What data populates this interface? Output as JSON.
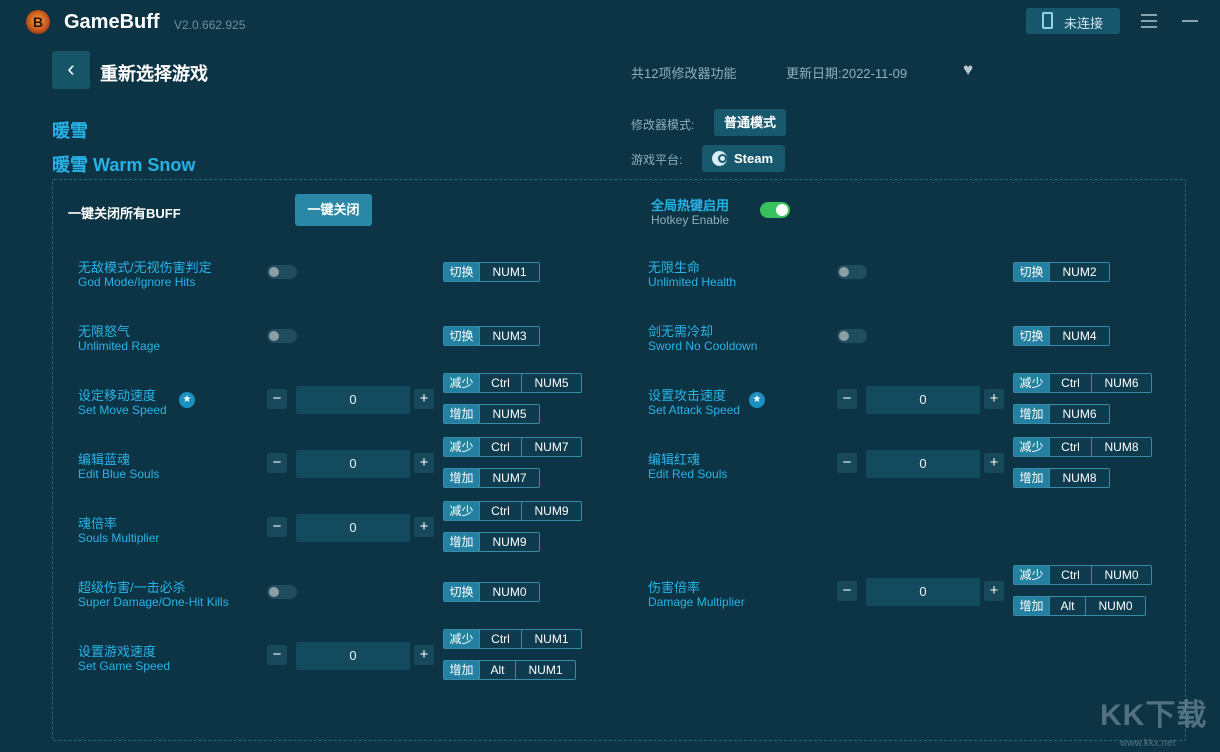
{
  "app": {
    "name": "GameBuff",
    "version": "V2.0.662.925",
    "logo_letter": "B",
    "connect_label": "未连接"
  },
  "header": {
    "back_label": "重新选择游戏",
    "feature_count": "共12项修改器功能",
    "update_date": "更新日期:2022-11-09"
  },
  "game": {
    "title_cn": "暖雪",
    "title_full": "暖雪 Warm Snow",
    "mode_label": "修改器模式:",
    "mode_value": "普通模式",
    "platform_label": "游戏平台:",
    "platform_value": "Steam"
  },
  "controls": {
    "close_all_label": "一键关闭所有BUFF",
    "close_all_button": "一键关闭",
    "hotkey_cn": "全局热键启用",
    "hotkey_en": "Hotkey Enable",
    "hotkey_enabled": true
  },
  "features": [
    {
      "cn": "无敌模式/无视伤害判定",
      "en": "God Mode/Ignore Hits",
      "type": "toggle",
      "hk1": {
        "action": "切换",
        "key": "NUM1"
      }
    },
    {
      "cn": "无限生命",
      "en": "Unlimited Health",
      "type": "toggle",
      "hk1": {
        "action": "切换",
        "key": "NUM2"
      }
    },
    {
      "cn": "无限怒气",
      "en": "Unlimited Rage",
      "type": "toggle",
      "hk1": {
        "action": "切换",
        "key": "NUM3"
      }
    },
    {
      "cn": "剑无需冷却",
      "en": "Sword No Cooldown",
      "type": "toggle",
      "hk1": {
        "action": "切换",
        "key": "NUM4"
      }
    },
    {
      "cn": "设定移动速度",
      "en": "Set Move Speed",
      "type": "number",
      "value": "0",
      "hk1": {
        "action": "减少",
        "mod": "Ctrl",
        "key": "NUM5"
      },
      "hk2": {
        "action": "增加",
        "key": "NUM5"
      }
    },
    {
      "cn": "设置攻击速度",
      "en": "Set Attack Speed",
      "type": "number",
      "value": "0",
      "hk1": {
        "action": "减少",
        "mod": "Ctrl",
        "key": "NUM6"
      },
      "hk2": {
        "action": "增加",
        "key": "NUM6"
      }
    },
    {
      "cn": "编辑蓝魂",
      "en": "Edit Blue Souls",
      "type": "number",
      "value": "0",
      "hk1": {
        "action": "减少",
        "mod": "Ctrl",
        "key": "NUM7"
      },
      "hk2": {
        "action": "增加",
        "key": "NUM7"
      }
    },
    {
      "cn": "编辑红魂",
      "en": "Edit Red Souls",
      "type": "number",
      "value": "0",
      "hk1": {
        "action": "减少",
        "mod": "Ctrl",
        "key": "NUM8"
      },
      "hk2": {
        "action": "增加",
        "key": "NUM8"
      }
    },
    {
      "cn": "魂倍率",
      "en": "Souls Multiplier",
      "type": "number",
      "value": "0",
      "hk1": {
        "action": "减少",
        "mod": "Ctrl",
        "key": "NUM9"
      },
      "hk2": {
        "action": "增加",
        "key": "NUM9"
      }
    },
    {
      "cn": "超级伤害/一击必杀",
      "en": "Super Damage/One-Hit Kills",
      "type": "toggle",
      "hk1": {
        "action": "切换",
        "key": "NUM0"
      }
    },
    {
      "cn": "伤害倍率",
      "en": "Damage Multiplier",
      "type": "number",
      "value": "0",
      "hk1": {
        "action": "减少",
        "mod": "Ctrl",
        "key": "NUM0"
      },
      "hk2": {
        "action": "增加",
        "mod": "Alt",
        "key": "NUM0"
      }
    },
    {
      "cn": "设置游戏速度",
      "en": "Set Game Speed",
      "type": "number",
      "value": "0",
      "hk1": {
        "action": "减少",
        "mod": "Ctrl",
        "key": "NUM1"
      },
      "hk2": {
        "action": "增加",
        "mod": "Alt",
        "key": "NUM1"
      }
    }
  ],
  "stepper": {
    "minus": "−",
    "plus": "+"
  },
  "watermark": {
    "text": "KK下载",
    "url": "www.kkx.net"
  },
  "colors": {
    "background": "#0c3445",
    "accent": "#27b2e6",
    "toggle_on": "#38c15d"
  }
}
